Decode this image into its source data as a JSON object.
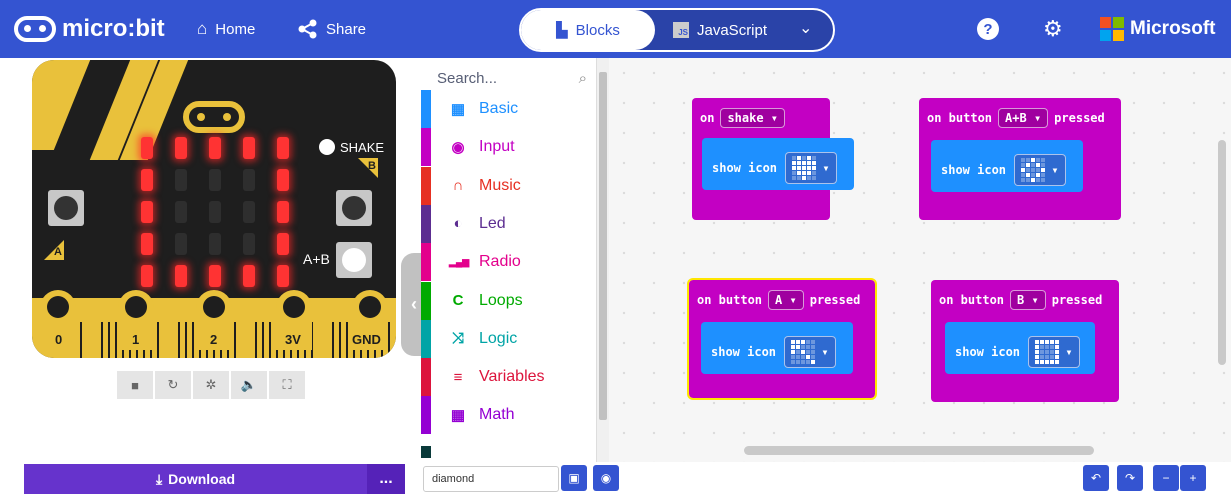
{
  "header": {
    "logo_text": "micro:bit",
    "home_label": "Home",
    "share_label": "Share",
    "blocks_label": "Blocks",
    "js_label": "JavaScript",
    "js_badge": "JS",
    "help_icon": "?",
    "brand_label": "Microsoft"
  },
  "simulator": {
    "pins": [
      "0",
      "1",
      "2",
      "3V",
      "GND"
    ],
    "button_a": "A",
    "button_b": "B",
    "button_ab": "A+B",
    "shake_label": "SHAKE",
    "led_matrix": [
      [
        1,
        1,
        1,
        1,
        1
      ],
      [
        1,
        0,
        0,
        0,
        1
      ],
      [
        1,
        0,
        0,
        0,
        1
      ],
      [
        1,
        0,
        0,
        0,
        1
      ],
      [
        1,
        1,
        1,
        1,
        1
      ]
    ]
  },
  "toolbox": {
    "search_placeholder": "Search...",
    "categories": [
      {
        "label": "Basic",
        "icon": "grid-icon",
        "color": "#1e90ff"
      },
      {
        "label": "Input",
        "icon": "radio-target-icon",
        "color": "#c300c3"
      },
      {
        "label": "Music",
        "icon": "headphones-icon",
        "color": "#e63022"
      },
      {
        "label": "Led",
        "icon": "toggle-icon",
        "color": "#5c2d91"
      },
      {
        "label": "Radio",
        "icon": "signal-bars-icon",
        "color": "#e3008c"
      },
      {
        "label": "Loops",
        "icon": "loop-icon",
        "color": "#00aa00"
      },
      {
        "label": "Logic",
        "icon": "shuffle-icon",
        "color": "#00a4a6"
      },
      {
        "label": "Variables",
        "icon": "lines-icon",
        "color": "#dc143c"
      },
      {
        "label": "Math",
        "icon": "calculator-icon",
        "color": "#9400d3"
      }
    ]
  },
  "workspace": {
    "block_shake": {
      "prefix": "on",
      "dropdown": "shake",
      "action": "show icon"
    },
    "block_ab": {
      "prefix": "on button",
      "dropdown": "A+B",
      "suffix": "pressed",
      "action": "show icon"
    },
    "block_a": {
      "prefix": "on button",
      "dropdown": "A",
      "suffix": "pressed",
      "action": "show icon"
    },
    "block_b": {
      "prefix": "on button",
      "dropdown": "B",
      "suffix": "pressed",
      "action": "show icon"
    }
  },
  "footer": {
    "download_label": "Download",
    "more_label": "...",
    "project_name": "diamond"
  }
}
